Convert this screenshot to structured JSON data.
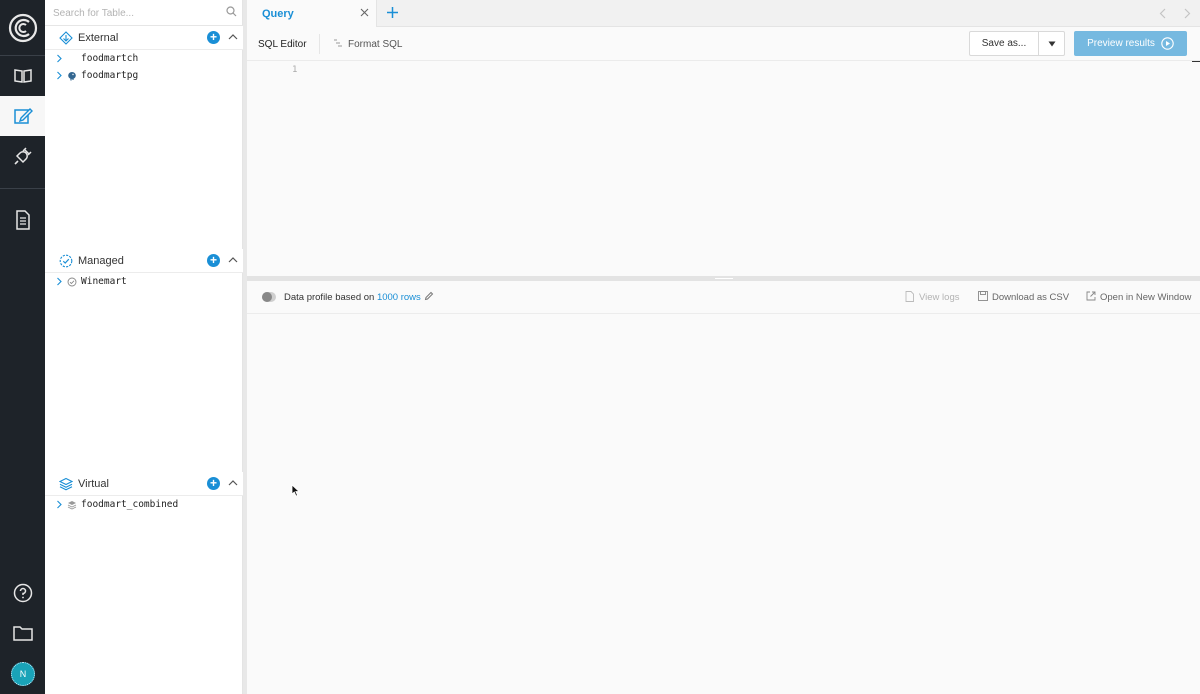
{
  "sidebar": {
    "search": {
      "placeholder": "Search for Table..."
    },
    "sections": [
      {
        "title": "External",
        "items": [
          "foodmartch",
          "foodmartpg"
        ]
      },
      {
        "title": "Managed",
        "items": [
          "Winemart"
        ]
      },
      {
        "title": "Virtual",
        "items": [
          "foodmart_combined"
        ]
      }
    ]
  },
  "rail": {
    "avatar_initial": "N"
  },
  "tabs": [
    {
      "label": "Query"
    }
  ],
  "toolbar": {
    "sql_editor_label": "SQL Editor",
    "format_sql_label": "Format SQL",
    "save_label": "Save as...",
    "preview_label": "Preview results"
  },
  "editor": {
    "line_numbers": [
      "1"
    ]
  },
  "results": {
    "profile_prefix": "Data profile based on ",
    "rows_link": "1000 rows",
    "view_logs": "View logs",
    "download_csv": "Download as CSV",
    "open_new_window": "Open in New Window"
  },
  "colors": {
    "accent": "#1a8fd6",
    "rail_bg": "#1e2329",
    "preview_button": "#76b9e0"
  }
}
